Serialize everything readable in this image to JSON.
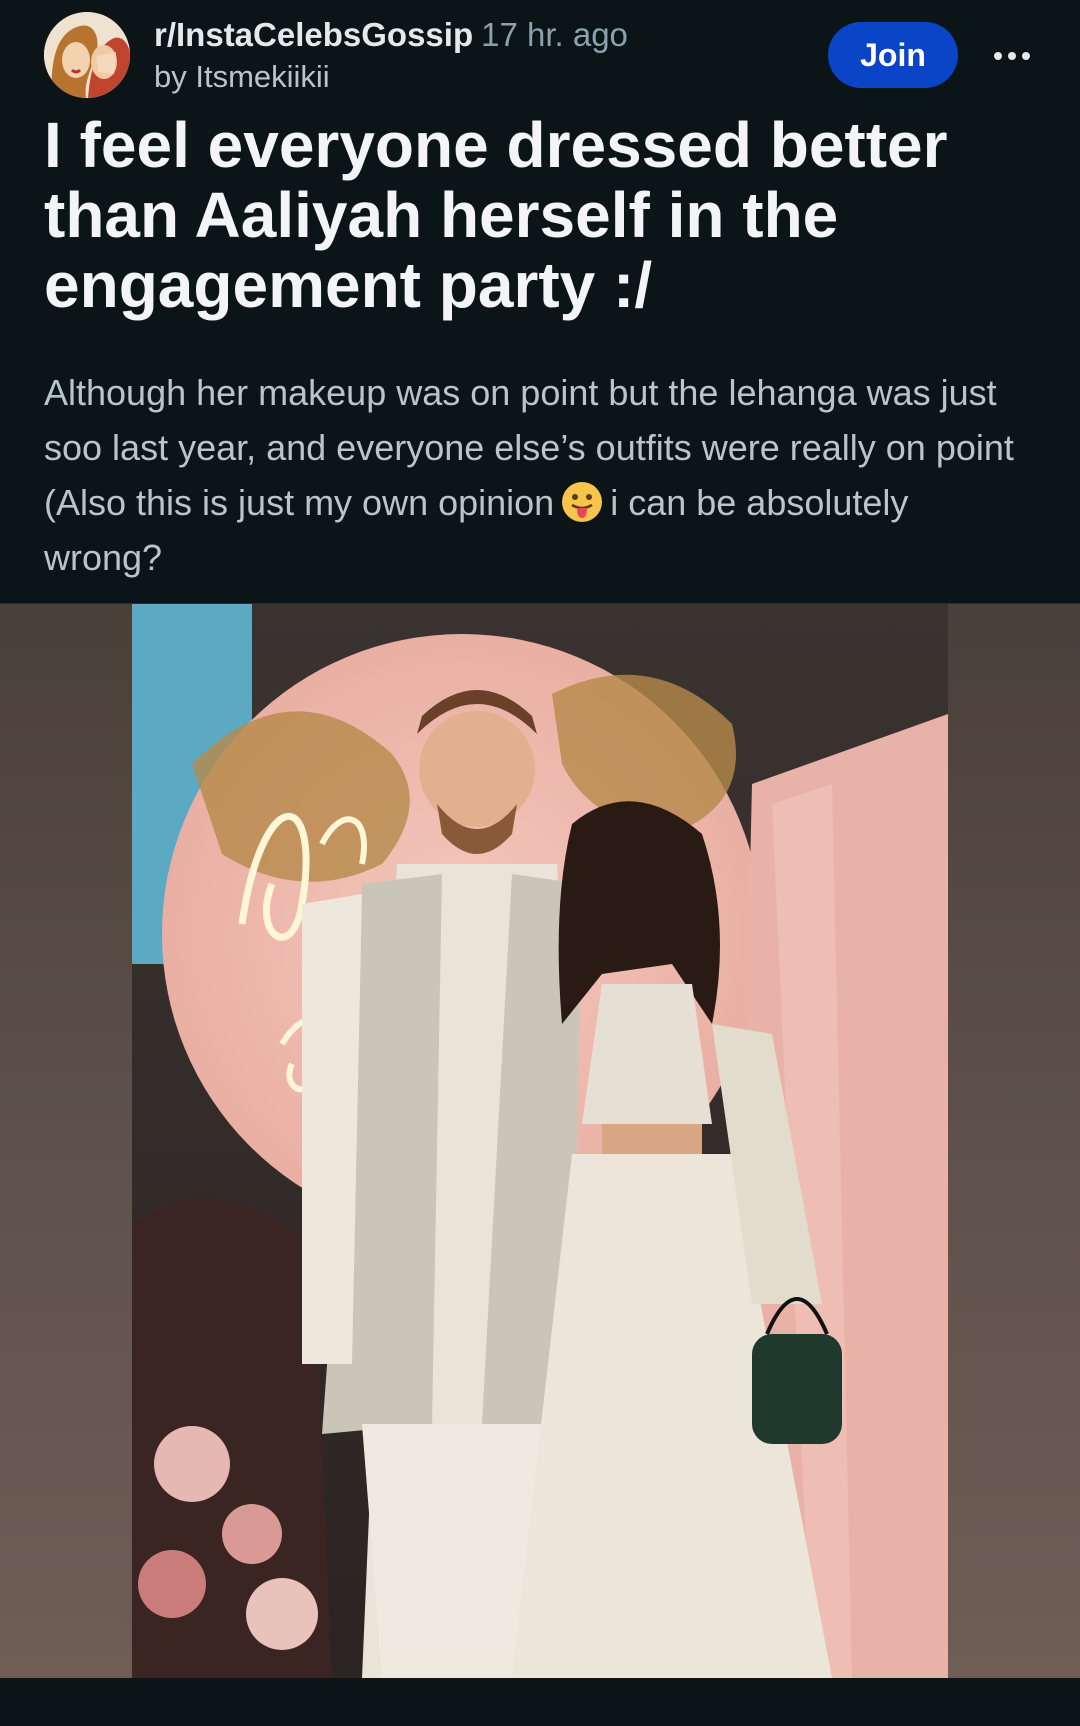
{
  "post": {
    "subreddit": "r/InstaCelebsGossip",
    "time": "17 hr. ago",
    "author": "by Itsmekiikii",
    "join_label": "Join",
    "title": "I feel everyone dressed better than Aaliyah herself in the engagement party :/",
    "body_part1": "Although her makeup was on point but the lehanga was just soo last year, and everyone else’s outfits were really on point (Also this is just my own opinion",
    "body_part2": "i can be absolutely wrong?"
  },
  "icons": {
    "avatar": "subreddit-avatar",
    "more": "more-options-icon",
    "emoji": "tongue-out-emoji"
  },
  "colors": {
    "background": "#0b1416",
    "join": "#0a45c7",
    "muted": "#8ba2ad"
  }
}
